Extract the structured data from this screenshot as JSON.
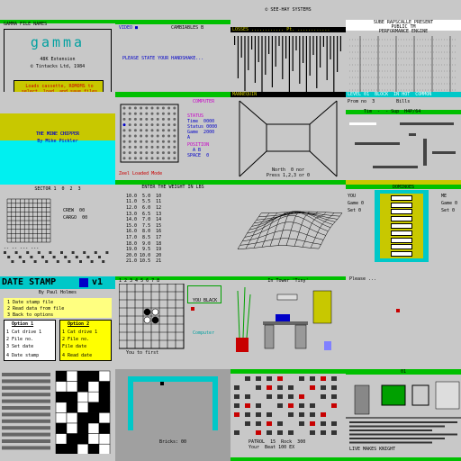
{
  "colors": {
    "spectrum_green": "#00c000",
    "spectrum_yellow": "#c8c800",
    "spectrum_cyan": "#00c8c8",
    "spectrum_blue": "#0000c8",
    "spectrum_red": "#c80000",
    "spectrum_magenta": "#c800c8",
    "grey": "#c8c8c8",
    "white": "#ffffff",
    "black": "#000000"
  },
  "tiles": {
    "gamma": {
      "header": "GAMMA FILE NAMES",
      "logo": "gamma",
      "lines": [
        "48K Extension",
        "© Tintacks Ltd, 1984"
      ],
      "box": "Loads cassette, ROMOMS to select, load, and save files"
    },
    "handshake": {
      "top": "VIDEO ■",
      "top_right": "CAMBIABLES B",
      "prompt": "PLEASE STATE YOUR HANDSHAKE..."
    },
    "systems": {
      "title": "© SEE-HAY SYSTEMS",
      "bar_label": "LOSSES ............ Pt. ............"
    },
    "adventure": {
      "title": "SUBE RAPSCALLE PRESENT",
      "sub": "PUBLIC TM",
      "subtitle": "PERFORMANCE ENGINE"
    },
    "mine": {
      "line1": "THE MINE CHIPPER",
      "line2": "By Mike Pickler"
    },
    "dotgrid": {
      "top_right": "COMPUTER",
      "stats": [
        "STATUS",
        "Time  0000",
        "Status 0000",
        "Game  2000",
        "A",
        "POSITION",
        "  A B",
        "SPACE  0"
      ],
      "footer": "Zeel Loaded Mode"
    },
    "maze3d": {
      "header": "MANNEQUIN",
      "bottom": "North  0 nor",
      "bottom2": "Press 1,2,3 or 0"
    },
    "platform": {
      "header": "LEVEL 01  BLOCK  IN HOT  COMMON",
      "sub": "Prom no  3        Bills",
      "bar": "Tim  -  - Sup  H4P/64"
    },
    "sector": {
      "title": "SECTOR 1  0  2  3",
      "labels": [
        "CREW  00",
        "CARGO  00"
      ],
      "footer": "-- -- --- ---"
    },
    "table": {
      "title": "ENTER THE WEIGHT IN LBS",
      "rows": [
        "10.0  5.0  10",
        "11.0  5.5  11",
        "12.0  6.0  12",
        "13.0  6.5  13",
        "14.0  7.0  14",
        "15.0  7.5  15",
        "16.0  8.0  16",
        "17.0  8.5  17",
        "18.0  9.0  18",
        "19.0  9.5  19",
        "20.0 10.0  20",
        "21.0 10.5  21"
      ]
    },
    "wireframe": {},
    "dominoes": {
      "header": "DOMINOES",
      "left_cols": [
        "YOU",
        "Game 0",
        "Set 0"
      ],
      "right_cols": [
        "ME",
        "Game 0",
        "Set 0"
      ]
    },
    "datestamp": {
      "title": "DATE STAMP",
      "version": "v1",
      "by": "By Paul Holmes",
      "menu": [
        "1 Date stamp file",
        "2 Read data from file",
        "3 Back to options"
      ],
      "option1_title": "Option 1",
      "option1": [
        "1 Cat drive 1",
        "2 File no.",
        "3 Set date",
        "4 Date stamp"
      ],
      "option2_title": "Option 2",
      "option2": [
        "1 Cat drive 1",
        "2 File no.",
        "File date",
        "4 Read date"
      ]
    },
    "othello": {
      "cols": "1 2 3 4 5 6 7 8",
      "side_label": "YOU BLACK",
      "footer": "You to first",
      "score_label": "Computer"
    },
    "office": {
      "header": "In Tower 'Tiny'"
    },
    "empty": {
      "text": "Please ..."
    },
    "crossword": {},
    "breakout": {
      "footer": "Bricks: 00"
    },
    "inventory": {
      "footer1": "PATROL  15  Rock  300",
      "footer2": "Your  Beat 100 EX"
    },
    "castle": {
      "msg": "LIVE MAKES KNIGHT",
      "bar": "01"
    }
  }
}
